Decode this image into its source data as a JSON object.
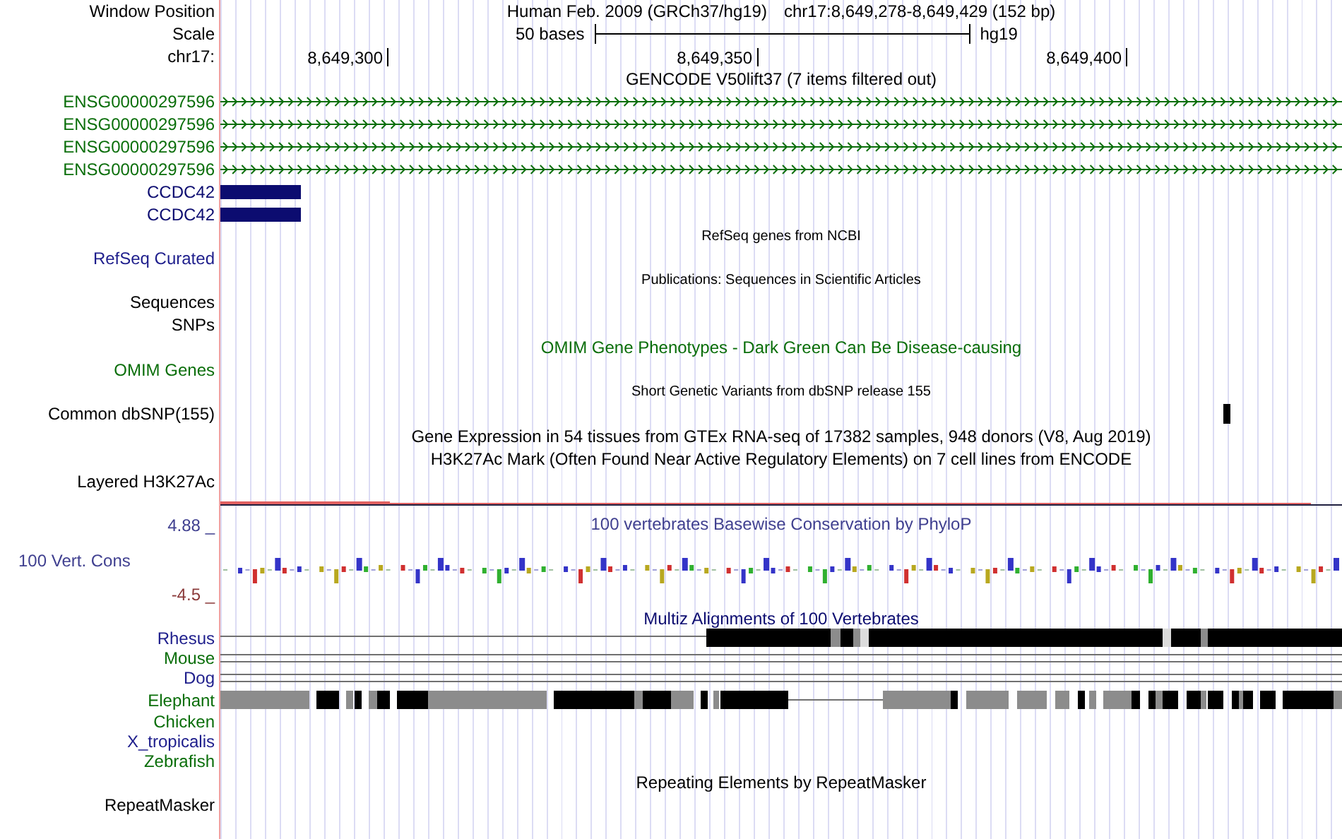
{
  "position": {
    "label": "Window Position",
    "assembly": "Human Feb. 2009 (GRCh37/hg19)",
    "range": "chr17:8,649,278-8,649,429 (152 bp)"
  },
  "scale": {
    "label": "Scale",
    "length": "50 bases",
    "assembly": "hg19"
  },
  "ruler": {
    "label": "chr17:",
    "ticks": [
      "8,649,300",
      "8,649,350",
      "8,649,400"
    ]
  },
  "tracks": [
    {
      "kind": "title",
      "text": "GENCODE V50lift37 (7 items filtered out)",
      "color": "#000000"
    },
    {
      "kind": "arrows",
      "label": "ENSG00000297596",
      "color": "#0a6e0a"
    },
    {
      "kind": "arrows",
      "label": "ENSG00000297596",
      "color": "#0a6e0a"
    },
    {
      "kind": "arrows",
      "label": "ENSG00000297596",
      "color": "#0a6e0a"
    },
    {
      "kind": "arrows",
      "label": "ENSG00000297596",
      "color": "#0a6e0a"
    },
    {
      "kind": "block",
      "label": "CCDC42",
      "color": "#0c0c70"
    },
    {
      "kind": "block",
      "label": "CCDC42",
      "color": "#0c0c70"
    },
    {
      "kind": "small_title",
      "text": "RefSeq genes from NCBI",
      "color": "#000000"
    },
    {
      "kind": "label",
      "label": "RefSeq Curated",
      "color": "#1e1e8c"
    },
    {
      "kind": "small_title",
      "text": "Publications: Sequences in Scientific Articles",
      "color": "#000000"
    },
    {
      "kind": "label",
      "label": "Sequences",
      "color": "#000000"
    },
    {
      "kind": "label",
      "label": "SNPs",
      "color": "#000000"
    },
    {
      "kind": "title",
      "text": "OMIM Gene Phenotypes - Dark Green Can Be Disease-causing",
      "color": "#0a6e0a"
    },
    {
      "kind": "label",
      "label": "OMIM Genes",
      "color": "#0a6e0a"
    },
    {
      "kind": "small_title",
      "text": "Short Genetic Variants from dbSNP release 155",
      "color": "#000000"
    },
    {
      "kind": "snp",
      "label": "Common dbSNP(155)",
      "color": "#000000"
    },
    {
      "kind": "title",
      "text": "Gene Expression in 54 tissues from GTEx RNA-seq of 17382 samples, 948 donors (V8, Aug 2019)",
      "color": "#000000"
    },
    {
      "kind": "title",
      "text": "H3K27Ac Mark (Often Found Near Active Regulatory Elements) on 7 cell lines from ENCODE",
      "color": "#000000"
    },
    {
      "kind": "label",
      "label": "Layered H3K27Ac",
      "color": "#000000"
    },
    {
      "kind": "signal",
      "color": "#e06060"
    }
  ],
  "conservation": {
    "title": "100 vertebrates Basewise Conservation by PhyloP",
    "label": "100 Vert. Cons",
    "max": "4.88 _",
    "min": "-4.5 _"
  },
  "multiz": {
    "title": "Multiz Alignments of 100 Vertebrates",
    "species": [
      {
        "name": "Rhesus",
        "color": "#1e1e8c"
      },
      {
        "name": "Mouse",
        "color": "#0a6e0a"
      },
      {
        "name": "Dog",
        "color": "#1e1e8c"
      },
      {
        "name": "Elephant",
        "color": "#0a6e0a"
      },
      {
        "name": "Chicken",
        "color": "#0a6e0a"
      },
      {
        "name": "X_tropicalis",
        "color": "#1e1e8c"
      },
      {
        "name": "Zebrafish",
        "color": "#0a6e0a"
      }
    ]
  },
  "repeats": {
    "title": "Repeating Elements by RepeatMasker",
    "label": "RepeatMasker"
  }
}
